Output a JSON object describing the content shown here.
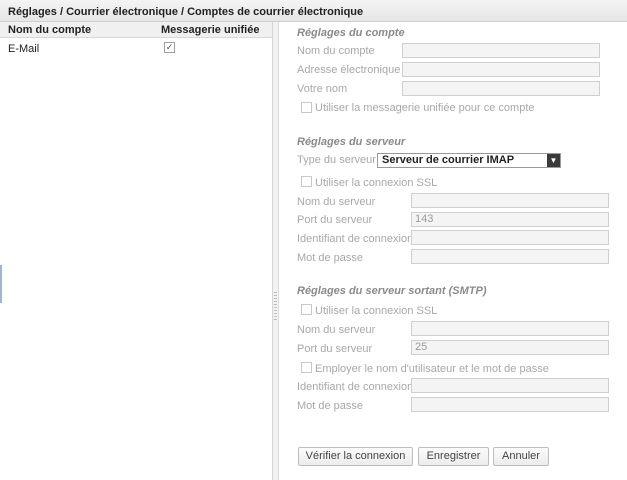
{
  "breadcrumb": "Réglages / Courrier électronique / Comptes de courrier électronique",
  "accounts": {
    "headers": {
      "name": "Nom du compte",
      "unified": "Messagerie unifiée"
    },
    "rows": [
      {
        "name": "E-Mail",
        "unified": true
      }
    ]
  },
  "account_settings": {
    "title": "Réglages du compte",
    "name_label": "Nom du compte",
    "email_label": "Adresse électronique",
    "display_name_label": "Votre nom",
    "unified_checkbox_label": "Utiliser la messagerie unifiée pour ce compte"
  },
  "server_settings": {
    "title": "Réglages du serveur",
    "type_label": "Type du serveur",
    "type_value": "Serveur de courrier IMAP",
    "ssl_label": "Utiliser la connexion SSL",
    "server_name_label": "Nom du serveur",
    "port_label": "Port du serveur",
    "port_value": "143",
    "login_label": "Identifiant de connexion",
    "password_label": "Mot de passe"
  },
  "smtp_settings": {
    "title": "Réglages du serveur sortant (SMTP)",
    "ssl_label": "Utiliser la connexion SSL",
    "server_name_label": "Nom du serveur",
    "port_label": "Port du serveur",
    "port_value": "25",
    "auth_label": "Employer le nom d'utilisateur et le mot de passe",
    "login_label": "Identifiant de connexion",
    "password_label": "Mot de passe"
  },
  "buttons": {
    "verify": "Vérifier la connexion",
    "save": "Enregistrer",
    "cancel": "Annuler"
  },
  "icons": {
    "check": "check-icon",
    "dropdown": "triangle-down-icon"
  }
}
